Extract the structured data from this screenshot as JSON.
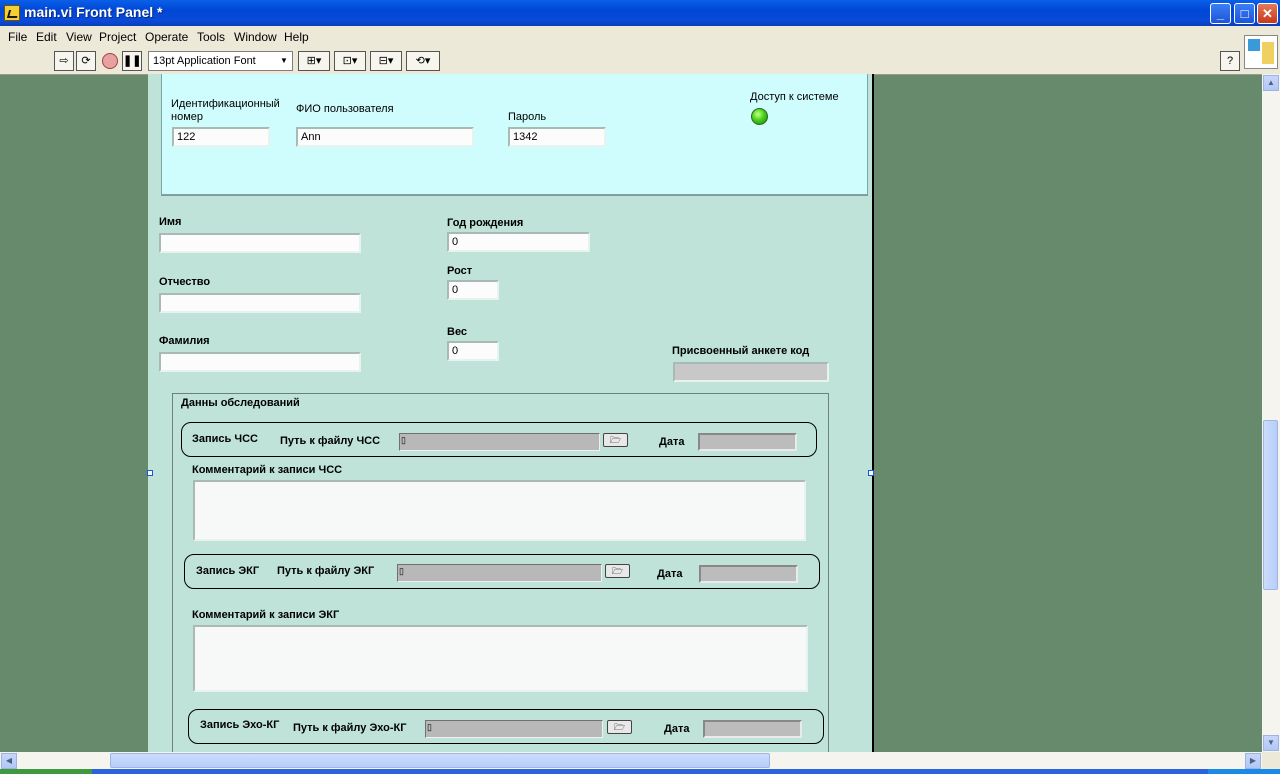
{
  "window": {
    "title": "main.vi Front Panel *",
    "controls": {
      "minimize": "_",
      "maximize": "□",
      "close": "✕"
    }
  },
  "menu": [
    "File",
    "Edit",
    "View",
    "Project",
    "Operate",
    "Tools",
    "Window",
    "Help"
  ],
  "toolbar": {
    "font": "13pt Application Font",
    "icons": [
      "run-arrow-icon",
      "run-continuously-icon",
      "abort-icon",
      "pause-icon",
      "align-icon",
      "distribute-icon",
      "resize-icon",
      "reorder-icon",
      "help-icon"
    ]
  },
  "login": {
    "id_label": "Идентификационный номер",
    "id_value": "122",
    "fio_label": "ФИО пользователя",
    "fio_value": "Ann",
    "password_label": "Пароль",
    "password_value": "1342",
    "access_label": "Доступ к системе",
    "access_color": "#47d11a"
  },
  "patient": {
    "first_name_label": "Имя",
    "first_name_value": "",
    "patronymic_label": "Отчество",
    "patronymic_value": "",
    "last_name_label": "Фамилия",
    "last_name_value": "",
    "birth_year_label": "Год рождения",
    "birth_year_value": "0",
    "height_label": "Рост",
    "height_value": "0",
    "weight_label": "Вес",
    "weight_value": "0",
    "code_label": "Присвоенный анкете код",
    "code_value": ""
  },
  "exams": {
    "title": "Данны обследований",
    "hrv": {
      "record_label": "Запись ЧСС",
      "path_label": "Путь к файлу ЧСС",
      "path_value": "",
      "date_label": "Дата",
      "comment_label": "Комментарий к записи ЧСС",
      "comment_value": ""
    },
    "ecg": {
      "record_label": "Запись ЭКГ",
      "path_label": "Путь к файлу ЭКГ",
      "path_value": "",
      "date_label": "Дата",
      "comment_label": "Комментарий к записи ЭКГ",
      "comment_value": ""
    },
    "echo": {
      "record_label": "Запись Эхо-КГ",
      "path_label": "Путь к файлу Эхо-КГ",
      "path_value": "",
      "date_label": "Дата"
    }
  },
  "colors": {
    "panel": "#bfe3d9",
    "login_box": "#cffcfc",
    "background": "#688a6c",
    "titlebar": "#0046d5"
  }
}
